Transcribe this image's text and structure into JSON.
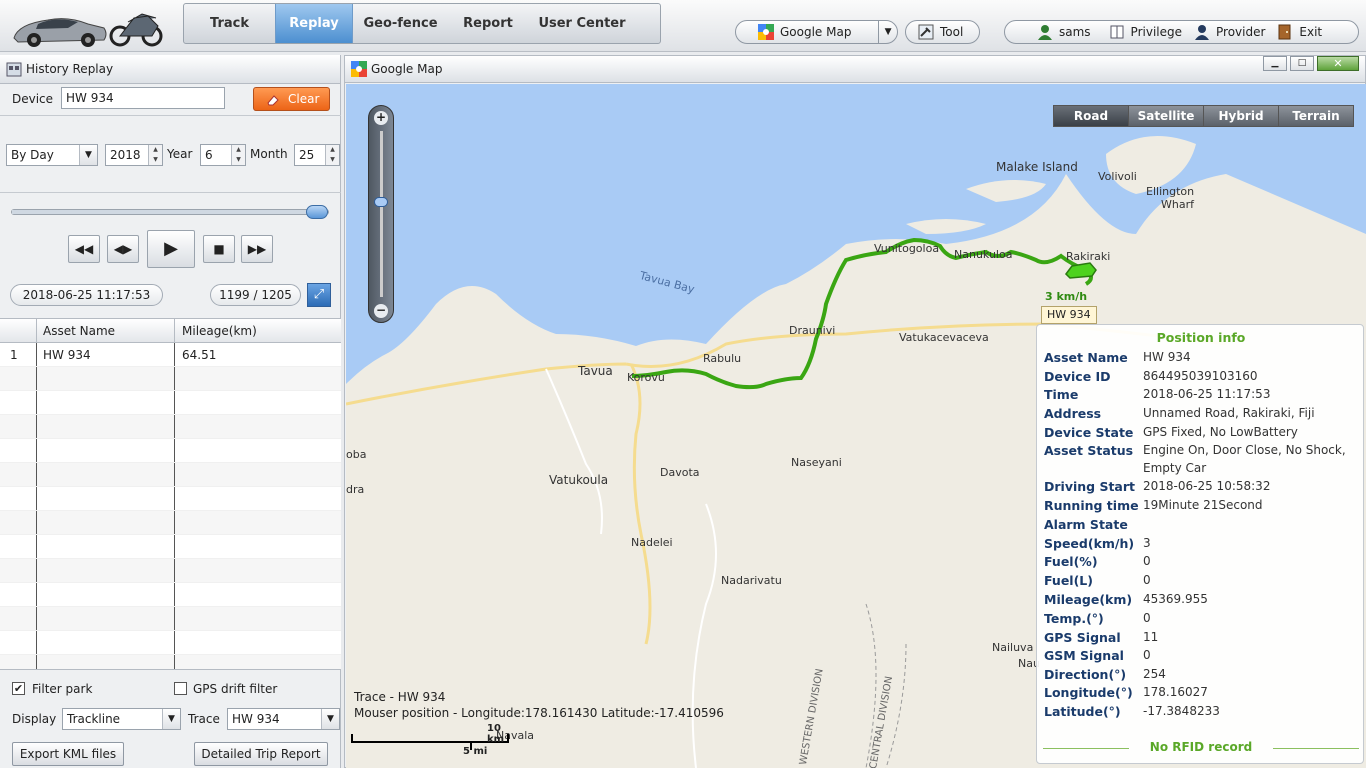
{
  "nav": {
    "tabs": [
      {
        "label": "Track"
      },
      {
        "label": "Replay",
        "active": true
      },
      {
        "label": "Geo-fence"
      },
      {
        "label": "Report"
      },
      {
        "label": "User Center"
      }
    ],
    "map_select": "Google Map",
    "tool": "Tool",
    "user": "sams",
    "privilege": "Privilege",
    "provider": "Provider",
    "exit": "Exit"
  },
  "left": {
    "title": "History Replay",
    "device_label": "Device",
    "device_value": "HW 934",
    "clear_label": "Clear",
    "mode": "By Day",
    "year_value": "2018",
    "year_label": "Year",
    "month_value": "6",
    "month_label": "Month",
    "day_value": "25",
    "slider_progress": 1.0,
    "timestamp": "2018-06-25 11:17:53",
    "position_counter": "1199 / 1205",
    "grid": {
      "headers": [
        "Asset Name",
        "Mileage(km)"
      ],
      "rows": [
        {
          "index": "1",
          "asset": "HW 934",
          "mileage": "64.51"
        }
      ]
    },
    "filter_park_label": "Filter park",
    "filter_park_checked": true,
    "gps_drift_label": "GPS drift filter",
    "gps_drift_checked": false,
    "display_label": "Display",
    "display_value": "Trackline",
    "trace_label": "Trace",
    "trace_value": "HW 934",
    "export_kml": "Export KML files",
    "trip_report": "Detailed Trip Report"
  },
  "map": {
    "title": "Google Map",
    "types": [
      "Road",
      "Satellite",
      "Hybrid",
      "Terrain"
    ],
    "selected_type": "Road",
    "places": {
      "malake": "Malake Island",
      "volivoli": "Volivoli",
      "ellington": "Ellington",
      "wharf": "Wharf",
      "rakiraki": "Rakiraki",
      "tavua_bay": "Tavua Bay",
      "vunitogoloa": "Vunitogoloa",
      "nasau": "Nanukuloa",
      "draunivi": "Draunivi",
      "vatukacevaceva": "Vatukacevaceva",
      "tavua": "Tavua",
      "korovu": "Korovu",
      "rabulu": "Rabulu",
      "oba": "oba",
      "dra": "dra",
      "davota": "Davota",
      "naseyani": "Naseyani",
      "vatukoula": "Vatukoula",
      "nadelei": "Nadelei",
      "nadarivatu": "Nadarivatu",
      "nailuva": "Nailuva",
      "nau": "Nau",
      "navala": "Navala",
      "western_division": "WESTERN DIVISION",
      "central_division": "CENTRAL DIVISION"
    },
    "vehicle_speed": "3 km/h",
    "vehicle_label": "HW 934",
    "trace_text": "Trace - HW 934",
    "mouse_position": "Mouser position - Longitude:178.161430 Latitude:-17.410596",
    "scale_km": "10 km",
    "scale_mi": "5 mi",
    "colors": {
      "water": "#a9cbf5",
      "land": "#efece3",
      "route": "#3aa613",
      "road": "#f5dc8f"
    }
  },
  "info": {
    "title": "Position info",
    "rows": [
      {
        "k": "Asset Name",
        "v": "HW 934"
      },
      {
        "k": "Device ID",
        "v": "864495039103160"
      },
      {
        "k": "Time",
        "v": "2018-06-25 11:17:53"
      },
      {
        "k": "Address",
        "v": "Unnamed Road, Rakiraki, Fiji"
      },
      {
        "k": "Device State",
        "v": "GPS Fixed, No LowBattery"
      },
      {
        "k": "Asset Status",
        "v": "Engine On, Door Close, No Shock,",
        "v2": "Empty Car"
      },
      {
        "k": "Driving Start",
        "v": "2018-06-25 10:58:32"
      },
      {
        "k": "Running time",
        "v": "19Minute 21Second"
      },
      {
        "k": "Alarm State",
        "v": ""
      },
      {
        "k": "Speed(km/h)",
        "v": "3"
      },
      {
        "k": "Fuel(%)",
        "v": "0"
      },
      {
        "k": "Fuel(L)",
        "v": "0"
      },
      {
        "k": "Mileage(km)",
        "v": "45369.955"
      },
      {
        "k": "Temp.(°)",
        "v": "0"
      },
      {
        "k": "GPS Signal",
        "v": "11"
      },
      {
        "k": "GSM Signal",
        "v": "0"
      },
      {
        "k": "Direction(°)",
        "v": "254"
      },
      {
        "k": "Longitude(°)",
        "v": "178.16027"
      },
      {
        "k": "Latitude(°)",
        "v": "-17.3848233"
      }
    ],
    "rfid": "No RFID record"
  }
}
